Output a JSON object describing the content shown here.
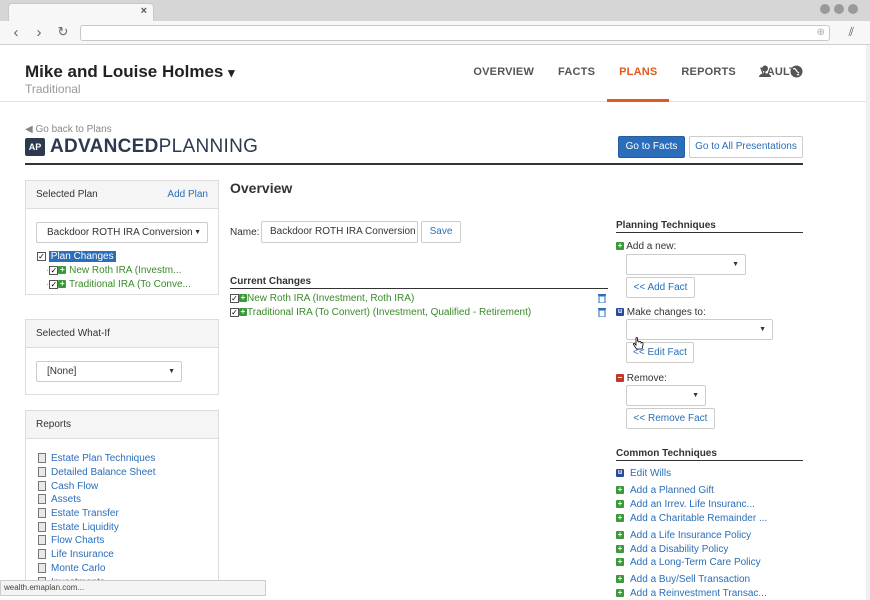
{
  "browser": {
    "tab_close": "×",
    "back": "‹",
    "forward": "›",
    "reload": "↻"
  },
  "header": {
    "client_name": "Mike and Louise Holmes",
    "client_caret": "▾",
    "client_sub": "Traditional",
    "nav": [
      "OVERVIEW",
      "FACTS",
      "PLANS",
      "REPORTS",
      "VAULT"
    ],
    "active_nav": "PLANS"
  },
  "page": {
    "back_link": "Go back to Plans",
    "logo_abbr": "AP",
    "title_bold": "ADVANCED",
    "title_light": "PLANNING",
    "go_to_facts": "Go to Facts",
    "go_to_presentations": "Go to All Presentations"
  },
  "selected_plan": {
    "heading": "Selected Plan",
    "add_plan": "Add Plan",
    "plan_select": "Backdoor ROTH IRA Conversion",
    "tree": {
      "root": "Plan Changes",
      "children": [
        "New Roth IRA (Investm...",
        "Traditional IRA (To Conve..."
      ]
    }
  },
  "selected_whatif": {
    "heading": "Selected What-If",
    "select": "[None]"
  },
  "reports": {
    "heading": "Reports",
    "items": [
      "Estate Plan Techniques",
      "Detailed Balance Sheet",
      "Cash Flow",
      "Assets",
      "Estate Transfer",
      "Estate Liquidity",
      "Flow Charts",
      "Life Insurance",
      "Monte Carlo",
      "Investments"
    ]
  },
  "main": {
    "title": "Overview",
    "name_label": "Name:",
    "name_value": "Backdoor ROTH IRA Conversion",
    "save": "Save",
    "current_changes_heading": "Current Changes",
    "changes": [
      "New Roth IRA (Investment, Roth IRA)",
      "Traditional IRA (To Convert) (Investment, Qualified - Retirement)"
    ]
  },
  "planning": {
    "heading": "Planning Techniques",
    "add_new": "Add a new:",
    "add_fact": "<< Add Fact",
    "make_changes": "Make changes to:",
    "edit_fact": "<< Edit Fact",
    "remove": "Remove:",
    "remove_fact": "<< Remove Fact"
  },
  "common": {
    "heading": "Common Techniques",
    "edit_wills": "Edit Wills",
    "group1": [
      "Add a Planned Gift",
      "Add an Irrev. Life Insuranc...",
      "Add a Charitable Remainder ..."
    ],
    "group2": [
      "Add a Life Insurance Policy",
      "Add a Disability Policy",
      "Add a Long-Term Care Policy"
    ],
    "group3": [
      "Add a Buy/Sell Transaction",
      "Add a Reinvestment Transac..."
    ]
  },
  "status_bar": "wealth.emaplan.com...",
  "colors": {
    "accent": "#e05a1f",
    "primary": "#2a6ebb",
    "green": "#3a8a2a",
    "navy": "#2c3a4f"
  }
}
